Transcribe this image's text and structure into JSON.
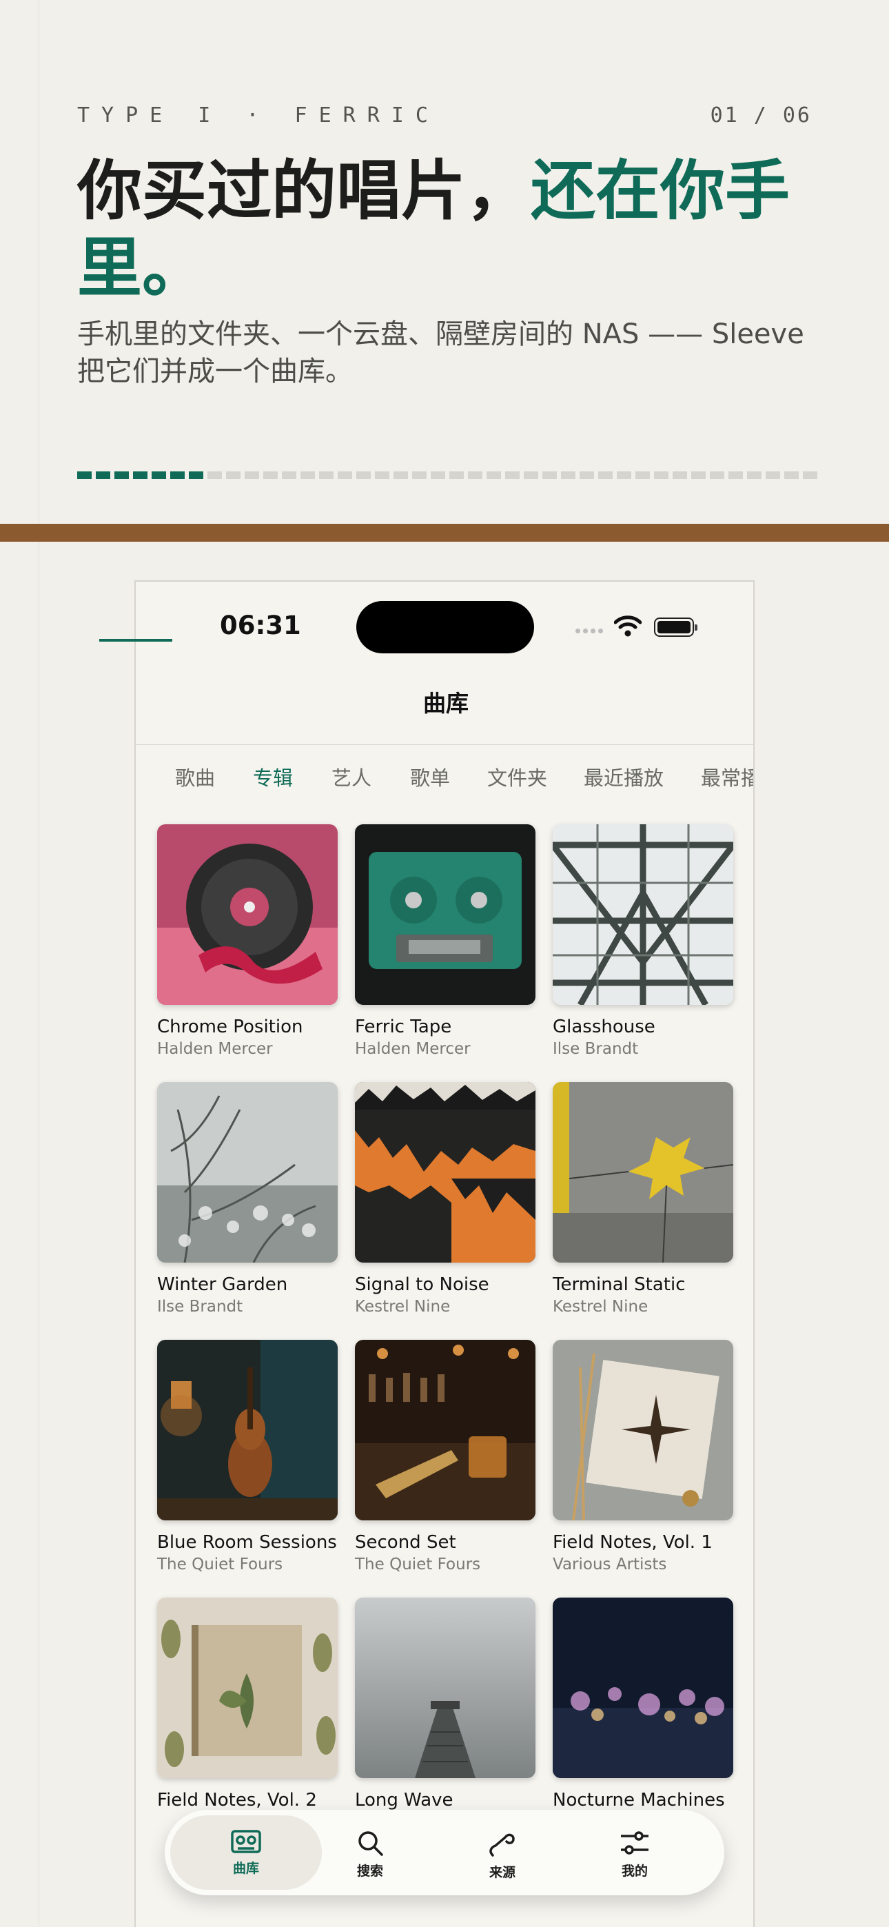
{
  "header": {
    "kicker": "TYPE I · FERRIC",
    "pager": "01 / 06",
    "headline_a": "你买过的唱片，",
    "headline_b": "还在你手里。",
    "sub": "手机里的文件夹、一个云盘、隔壁房间的 NAS —— Sleeve 把它们并成一个曲库。",
    "progress": {
      "total": 40,
      "done": 7
    }
  },
  "colors": {
    "accent": "#0f6b57",
    "band": "#8b5a2e",
    "background": "#f1f0eb"
  },
  "status_bar": {
    "time": "06:31"
  },
  "nav": {
    "title": "曲库"
  },
  "tabs": [
    "歌曲",
    "专辑",
    "艺人",
    "歌单",
    "文件夹",
    "最近播放",
    "最常播"
  ],
  "active_tab": 1,
  "albums": [
    {
      "title": "Chrome Position",
      "artist": "Halden Mercer"
    },
    {
      "title": "Ferric Tape",
      "artist": "Halden Mercer"
    },
    {
      "title": "Glasshouse",
      "artist": "Ilse Brandt"
    },
    {
      "title": "Winter Garden",
      "artist": "Ilse Brandt"
    },
    {
      "title": "Signal to Noise",
      "artist": "Kestrel Nine"
    },
    {
      "title": "Terminal Static",
      "artist": "Kestrel Nine"
    },
    {
      "title": "Blue Room Sessions",
      "artist": "The Quiet Fours"
    },
    {
      "title": "Second Set",
      "artist": "The Quiet Fours"
    },
    {
      "title": "Field Notes, Vol. 1",
      "artist": "Various Artists"
    },
    {
      "title": "Field Notes, Vol. 2",
      "artist": ""
    },
    {
      "title": "Long Wave",
      "artist": ""
    },
    {
      "title": "Nocturne Machines",
      "artist": ""
    }
  ],
  "tabbar": [
    {
      "label": "曲库",
      "icon": "cassette-icon"
    },
    {
      "label": "搜索",
      "icon": "search-icon"
    },
    {
      "label": "来源",
      "icon": "link-icon"
    },
    {
      "label": "我的",
      "icon": "sliders-icon"
    }
  ]
}
